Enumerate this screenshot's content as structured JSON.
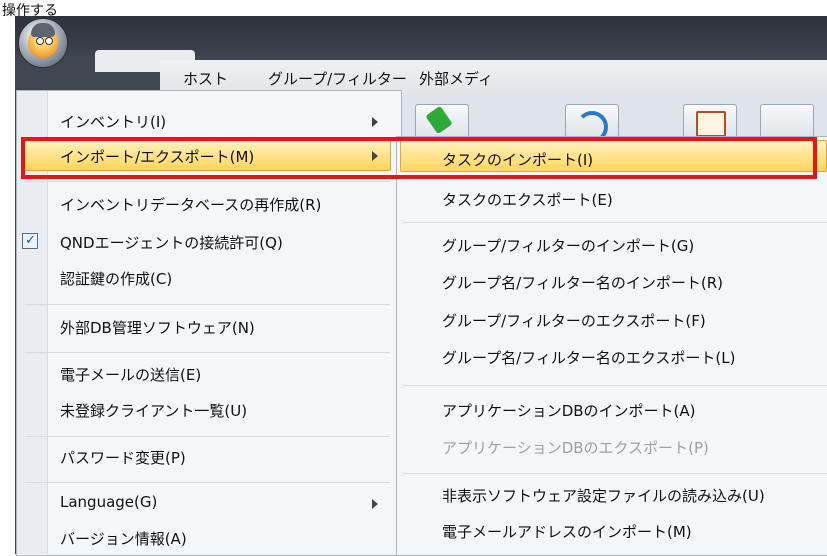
{
  "top_label": "操作する",
  "menubar": {
    "items": [
      "ホスト",
      "グループ/フィルター",
      "外部メディ"
    ]
  },
  "main_menu": {
    "items": [
      {
        "label": "インベントリ(I)",
        "has_submenu": true
      },
      {
        "label": "インポート/エクスポート(M)",
        "has_submenu": true,
        "highlighted": true
      },
      {
        "label": "インベントリデータベースの再作成(R)"
      },
      {
        "label": "QNDエージェントの接続許可(Q)",
        "checked": true
      },
      {
        "label": "認証鍵の作成(C)"
      },
      {
        "label": "外部DB管理ソフトウェア(N)"
      },
      {
        "label": "電子メールの送信(E)"
      },
      {
        "label": "未登録クライアント一覧(U)"
      },
      {
        "label": "パスワード変更(P)"
      },
      {
        "label": "Language(G)",
        "has_submenu": true
      },
      {
        "label": "バージョン情報(A)"
      }
    ]
  },
  "sub_menu": {
    "items": [
      {
        "label": "タスクのインポート(I)",
        "highlighted": true
      },
      {
        "label": "タスクのエクスポート(E)"
      },
      {
        "label": "グループ/フィルターのインポート(G)"
      },
      {
        "label": "グループ名/フィルター名のインポート(R)"
      },
      {
        "label": "グループ/フィルターのエクスポート(F)"
      },
      {
        "label": "グループ名/フィルター名のエクスポート(L)"
      },
      {
        "label": "アプリケーションDBのインポート(A)"
      },
      {
        "label": "アプリケーションDBのエクスポート(P)",
        "disabled": true
      },
      {
        "label": "非表示ソフトウェア設定ファイルの読み込み(U)"
      },
      {
        "label": "電子メールアドレスのインポート(M)"
      }
    ]
  },
  "colors": {
    "highlight": "#ffd45a",
    "annotation": "#e41616",
    "check": "#1e4fa8"
  }
}
